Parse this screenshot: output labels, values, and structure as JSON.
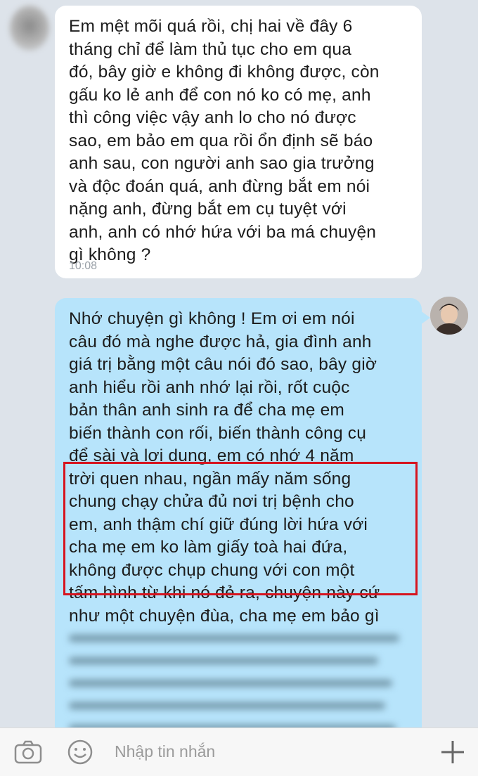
{
  "incoming": {
    "text": "Em mệt mõi quá rồi, chị hai về đây 6\ntháng chỉ để làm thủ tục cho em qua\nđó, bây giờ e không đi không được, còn\ngấu ko lẻ anh để con nó ko có mẹ, anh\nthì công việc vậy anh lo cho nó được\nsao, em bảo em qua rồi ổn định sẽ báo\nanh sau, con người anh sao gia trưởng\nvà độc đoán quá, anh đừng bắt em nói\nnặng anh, đừng bắt em cụ tuyệt với\nanh, anh có nhớ  hứa với ba má chuyện\ngì không ?",
    "time": "10:08"
  },
  "outgoing": {
    "text": "Nhớ chuyện gì không ! Em ơi em nói\ncâu đó mà nghe được hả, gia đình anh\ngiá trị bằng một câu nói đó sao, bây giờ\nanh hiểu rồi anh nhớ lại rồi, rốt cuộc\nbản thân anh sinh ra để cha mẹ em\nbiến thành con rối, biến thành công cụ\nđể sài và lợi dụng, em có nhớ 4 năm\ntrời quen nhau, ngần mấy năm sống\nchung chạy chửa đủ nơi trị bệnh cho\nem, anh thậm chí giữ đúng lời hứa với\ncha mẹ em ko làm giấy toà hai đứa,\nkhông được chụp chung với con một\ntấm hình từ khi nó đẻ ra, chuyện này cứ\nnhư một chuyện đùa, cha mẹ em bảo gì"
  },
  "input_bar": {
    "placeholder": "Nhập tin nhắn"
  },
  "colors": {
    "incoming_bubble": "#ffffff",
    "outgoing_bubble": "#b7e4fb",
    "highlight_border": "#d6141f",
    "background": "#dde3ea"
  },
  "icons": [
    "camera-icon",
    "emoji-icon",
    "plus-icon"
  ]
}
